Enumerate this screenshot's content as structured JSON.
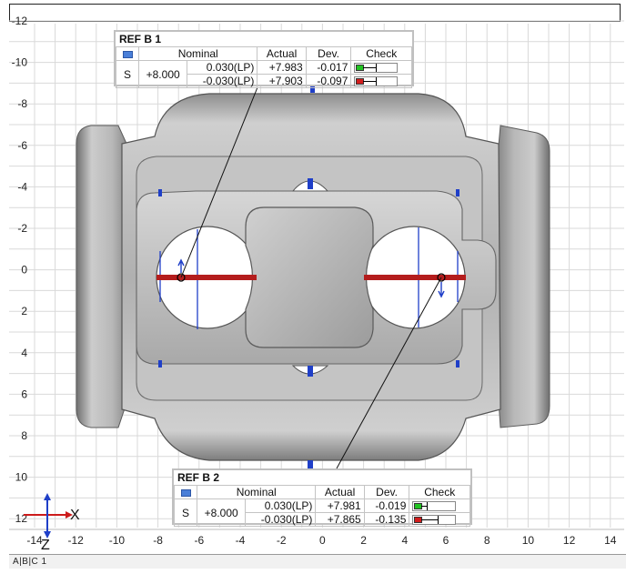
{
  "status_bar": {
    "label": "A|B|C 1"
  },
  "axis": {
    "x_ticks": [
      "-14",
      "-12",
      "-10",
      "-8",
      "-6",
      "-4",
      "-2",
      "0",
      "2",
      "4",
      "6",
      "8",
      "10",
      "12",
      "14"
    ],
    "y_ticks": [
      "-12",
      "-10",
      "-8",
      "-6",
      "-4",
      "-2",
      "0",
      "2",
      "4",
      "6",
      "8",
      "10",
      "12"
    ],
    "triad_x_label": "X",
    "triad_z_label": "Z"
  },
  "ref_b1": {
    "title": "REF B 1",
    "headers": {
      "nominal": "Nominal",
      "actual": "Actual",
      "dev": "Dev.",
      "check": "Check"
    },
    "type": "S",
    "nominal_value": "+8.000",
    "tol_upper": "0.030(LP)",
    "tol_lower": "-0.030(LP)",
    "actual_upper": "+7.983",
    "actual_lower": "+7.903",
    "dev_upper": "-0.017",
    "dev_lower": "-0.097",
    "check_upper_color": "#22c322",
    "check_lower_color": "#d21d1d"
  },
  "ref_b2": {
    "title": "REF B 2",
    "headers": {
      "nominal": "Nominal",
      "actual": "Actual",
      "dev": "Dev.",
      "check": "Check"
    },
    "type": "S",
    "nominal_value": "+8.000",
    "tol_upper": "0.030(LP)",
    "tol_lower": "-0.030(LP)",
    "actual_upper": "+7.981",
    "actual_lower": "+7.865",
    "dev_upper": "-0.019",
    "dev_lower": "-0.135",
    "check_upper_color": "#22c322",
    "check_lower_color": "#d21d1d"
  },
  "colors": {
    "measure_bar": "#b41d1d",
    "datum_marker": "#1f3fc8",
    "grid": "#d9d9d9"
  }
}
